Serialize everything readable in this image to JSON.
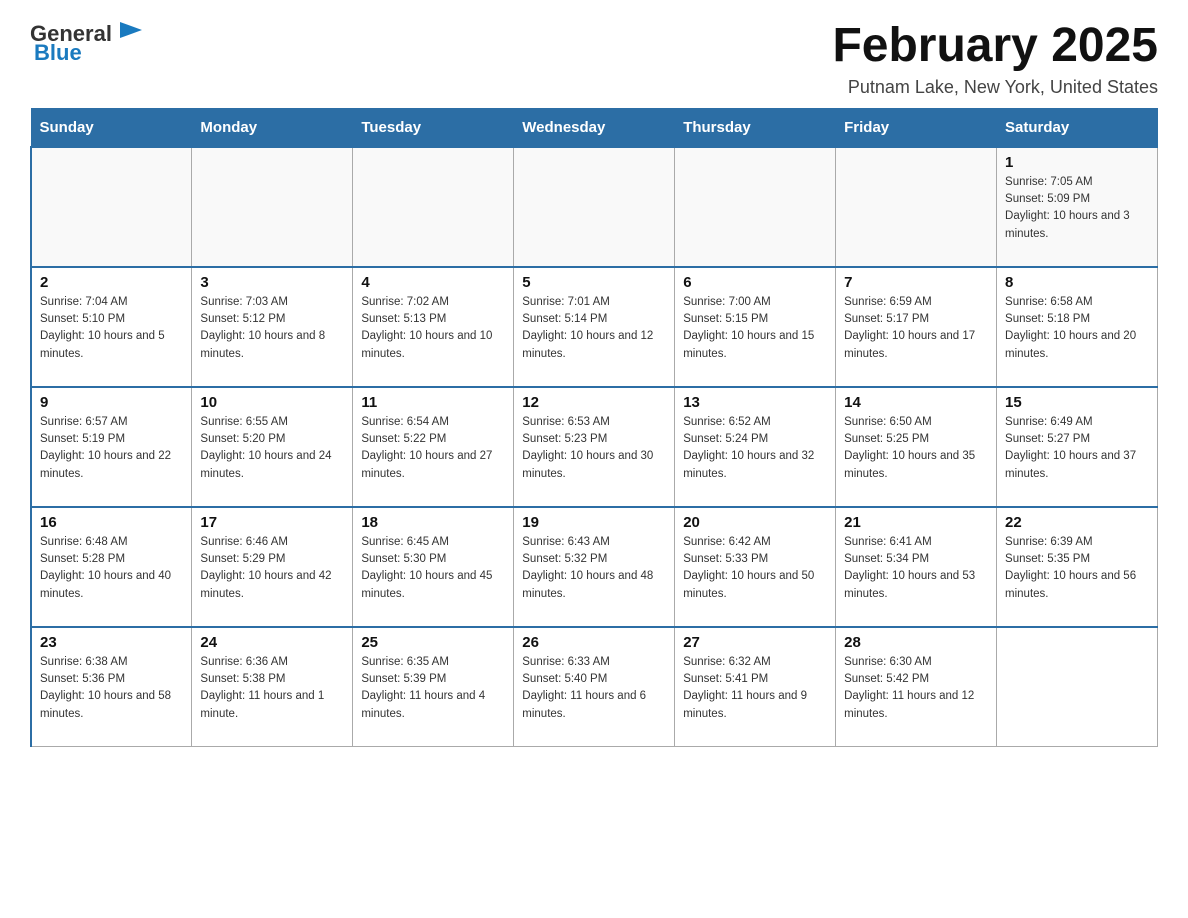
{
  "header": {
    "logo_text_main": "General",
    "logo_text_blue": "Blue",
    "month_title": "February 2025",
    "location": "Putnam Lake, New York, United States"
  },
  "days_of_week": [
    "Sunday",
    "Monday",
    "Tuesday",
    "Wednesday",
    "Thursday",
    "Friday",
    "Saturday"
  ],
  "weeks": [
    [
      {
        "day": "",
        "info": ""
      },
      {
        "day": "",
        "info": ""
      },
      {
        "day": "",
        "info": ""
      },
      {
        "day": "",
        "info": ""
      },
      {
        "day": "",
        "info": ""
      },
      {
        "day": "",
        "info": ""
      },
      {
        "day": "1",
        "info": "Sunrise: 7:05 AM\nSunset: 5:09 PM\nDaylight: 10 hours and 3 minutes."
      }
    ],
    [
      {
        "day": "2",
        "info": "Sunrise: 7:04 AM\nSunset: 5:10 PM\nDaylight: 10 hours and 5 minutes."
      },
      {
        "day": "3",
        "info": "Sunrise: 7:03 AM\nSunset: 5:12 PM\nDaylight: 10 hours and 8 minutes."
      },
      {
        "day": "4",
        "info": "Sunrise: 7:02 AM\nSunset: 5:13 PM\nDaylight: 10 hours and 10 minutes."
      },
      {
        "day": "5",
        "info": "Sunrise: 7:01 AM\nSunset: 5:14 PM\nDaylight: 10 hours and 12 minutes."
      },
      {
        "day": "6",
        "info": "Sunrise: 7:00 AM\nSunset: 5:15 PM\nDaylight: 10 hours and 15 minutes."
      },
      {
        "day": "7",
        "info": "Sunrise: 6:59 AM\nSunset: 5:17 PM\nDaylight: 10 hours and 17 minutes."
      },
      {
        "day": "8",
        "info": "Sunrise: 6:58 AM\nSunset: 5:18 PM\nDaylight: 10 hours and 20 minutes."
      }
    ],
    [
      {
        "day": "9",
        "info": "Sunrise: 6:57 AM\nSunset: 5:19 PM\nDaylight: 10 hours and 22 minutes."
      },
      {
        "day": "10",
        "info": "Sunrise: 6:55 AM\nSunset: 5:20 PM\nDaylight: 10 hours and 24 minutes."
      },
      {
        "day": "11",
        "info": "Sunrise: 6:54 AM\nSunset: 5:22 PM\nDaylight: 10 hours and 27 minutes."
      },
      {
        "day": "12",
        "info": "Sunrise: 6:53 AM\nSunset: 5:23 PM\nDaylight: 10 hours and 30 minutes."
      },
      {
        "day": "13",
        "info": "Sunrise: 6:52 AM\nSunset: 5:24 PM\nDaylight: 10 hours and 32 minutes."
      },
      {
        "day": "14",
        "info": "Sunrise: 6:50 AM\nSunset: 5:25 PM\nDaylight: 10 hours and 35 minutes."
      },
      {
        "day": "15",
        "info": "Sunrise: 6:49 AM\nSunset: 5:27 PM\nDaylight: 10 hours and 37 minutes."
      }
    ],
    [
      {
        "day": "16",
        "info": "Sunrise: 6:48 AM\nSunset: 5:28 PM\nDaylight: 10 hours and 40 minutes."
      },
      {
        "day": "17",
        "info": "Sunrise: 6:46 AM\nSunset: 5:29 PM\nDaylight: 10 hours and 42 minutes."
      },
      {
        "day": "18",
        "info": "Sunrise: 6:45 AM\nSunset: 5:30 PM\nDaylight: 10 hours and 45 minutes."
      },
      {
        "day": "19",
        "info": "Sunrise: 6:43 AM\nSunset: 5:32 PM\nDaylight: 10 hours and 48 minutes."
      },
      {
        "day": "20",
        "info": "Sunrise: 6:42 AM\nSunset: 5:33 PM\nDaylight: 10 hours and 50 minutes."
      },
      {
        "day": "21",
        "info": "Sunrise: 6:41 AM\nSunset: 5:34 PM\nDaylight: 10 hours and 53 minutes."
      },
      {
        "day": "22",
        "info": "Sunrise: 6:39 AM\nSunset: 5:35 PM\nDaylight: 10 hours and 56 minutes."
      }
    ],
    [
      {
        "day": "23",
        "info": "Sunrise: 6:38 AM\nSunset: 5:36 PM\nDaylight: 10 hours and 58 minutes."
      },
      {
        "day": "24",
        "info": "Sunrise: 6:36 AM\nSunset: 5:38 PM\nDaylight: 11 hours and 1 minute."
      },
      {
        "day": "25",
        "info": "Sunrise: 6:35 AM\nSunset: 5:39 PM\nDaylight: 11 hours and 4 minutes."
      },
      {
        "day": "26",
        "info": "Sunrise: 6:33 AM\nSunset: 5:40 PM\nDaylight: 11 hours and 6 minutes."
      },
      {
        "day": "27",
        "info": "Sunrise: 6:32 AM\nSunset: 5:41 PM\nDaylight: 11 hours and 9 minutes."
      },
      {
        "day": "28",
        "info": "Sunrise: 6:30 AM\nSunset: 5:42 PM\nDaylight: 11 hours and 12 minutes."
      },
      {
        "day": "",
        "info": ""
      }
    ]
  ]
}
